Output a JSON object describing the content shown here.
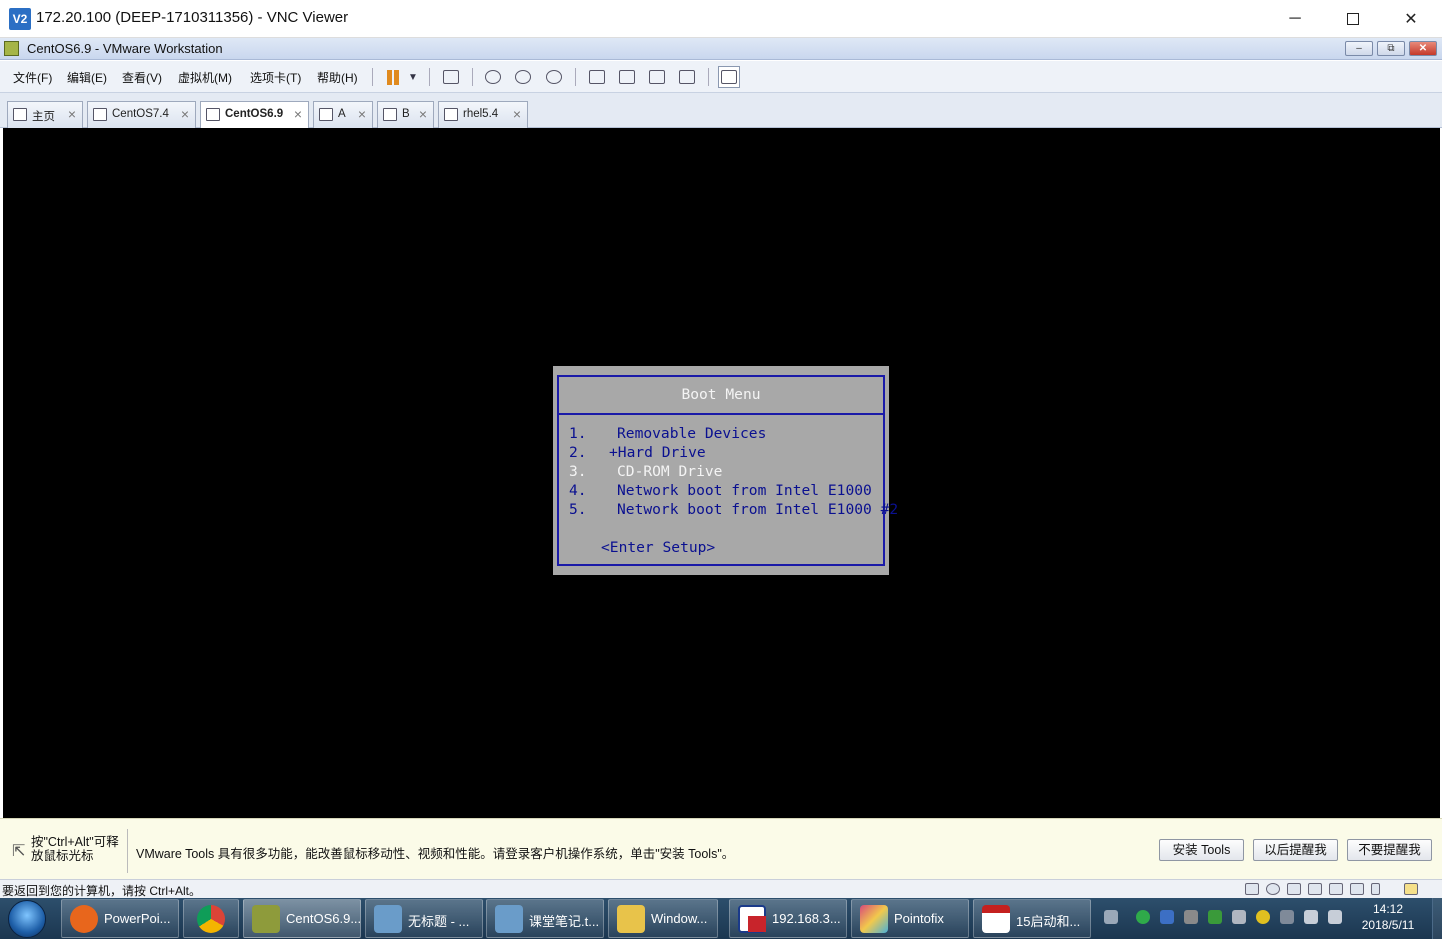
{
  "vnc": {
    "logo": "V2",
    "title": "172.20.100 (DEEP-1710311356) - VNC Viewer",
    "minimize": "─",
    "close": "✕"
  },
  "vmware": {
    "title": "CentOS6.9 - VMware Workstation",
    "min": "‒",
    "restore": "⧉",
    "close": "✕"
  },
  "menu": [
    "文件(F)",
    "编辑(E)",
    "查看(V)",
    "虚拟机(M)",
    "选项卡(T)",
    "帮助(H)"
  ],
  "toolbar_icons": [
    "pause-icon",
    "dropdown-arrow-icon",
    "send-ctrl-alt-del-icon",
    "snapshot-take-icon",
    "snapshot-revert-icon",
    "snapshot-manager-icon",
    "sidebar-toggle-icon",
    "console-view-icon",
    "fullscreen-icon",
    "unity-icon",
    "thumbnail-view-icon"
  ],
  "tabs": [
    {
      "label": "主页",
      "icon": "home-icon",
      "active": false
    },
    {
      "label": "CentOS7.4",
      "icon": "vm-icon",
      "active": false
    },
    {
      "label": "CentOS6.9",
      "icon": "vm-icon",
      "active": true
    },
    {
      "label": "A",
      "icon": "vm-icon",
      "active": false
    },
    {
      "label": "B",
      "icon": "vm-icon",
      "active": false
    },
    {
      "label": "rhel5.4",
      "icon": "vm-icon",
      "active": false
    }
  ],
  "tab_close": "×",
  "boot_menu": {
    "title": "Boot Menu",
    "items": [
      {
        "num": "1.",
        "label": "Removable Devices"
      },
      {
        "num": "2.",
        "label": "+Hard Drive"
      },
      {
        "num": "3.",
        "label": "CD-ROM Drive"
      },
      {
        "num": "4.",
        "label": "Network boot from Intel E1000"
      },
      {
        "num": "5.",
        "label": "Network boot from Intel E1000 #2"
      }
    ],
    "setup": "<Enter Setup>"
  },
  "hint": {
    "cursor": "⇱",
    "left": "按\"Ctrl+Alt\"可释放鼠标光标",
    "message": "VMware Tools 具有很多功能，能改善鼠标移动性、视频和性能。请登录客户机操作系统，单击\"安装 Tools\"。",
    "buttons": [
      "安装 Tools",
      "以后提醒我",
      "不要提醒我"
    ]
  },
  "status": {
    "text": "要返回到您的计算机，请按 Ctrl+Alt。"
  },
  "taskbar": {
    "items": [
      {
        "label": "PowerPoi...",
        "icon": "firefox-icon",
        "color": "#e8661c"
      },
      {
        "label": "",
        "icon": "chrome-icon",
        "color": "#2e9b45"
      },
      {
        "label": "CentOS6.9...",
        "icon": "vmware-icon",
        "color": "#8e9b3b"
      },
      {
        "label": "无标题 - ...",
        "icon": "notepad-icon",
        "color": "#6a9cc9"
      },
      {
        "label": "课堂笔记.t...",
        "icon": "notepad-icon",
        "color": "#6a9cc9"
      },
      {
        "label": "Window...",
        "icon": "folder-icon",
        "color": "#e8c34a"
      },
      {
        "label": "192.168.3...",
        "icon": "remote-desktop-icon",
        "color": "#c8242b"
      },
      {
        "label": "Pointofix",
        "icon": "pointofix-icon",
        "color": "#d84a7a"
      },
      {
        "label": "15启动和...",
        "icon": "pdf-icon",
        "color": "#c4201f"
      }
    ],
    "time": "14:12",
    "date": "2018/5/11"
  }
}
